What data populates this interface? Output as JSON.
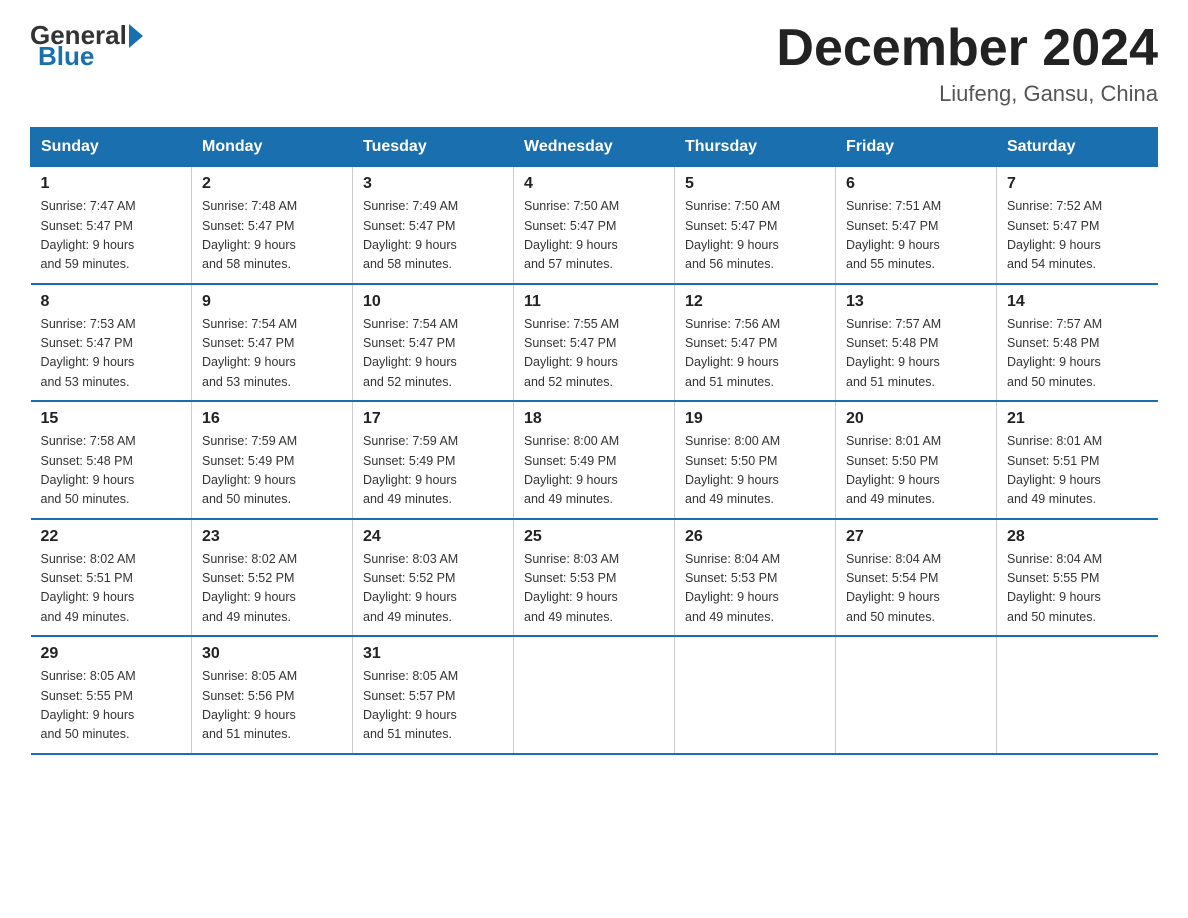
{
  "header": {
    "logo_general": "General",
    "logo_blue": "Blue",
    "month_title": "December 2024",
    "location": "Liufeng, Gansu, China"
  },
  "weekdays": [
    "Sunday",
    "Monday",
    "Tuesday",
    "Wednesday",
    "Thursday",
    "Friday",
    "Saturday"
  ],
  "weeks": [
    [
      {
        "day": "1",
        "info": "Sunrise: 7:47 AM\nSunset: 5:47 PM\nDaylight: 9 hours\nand 59 minutes."
      },
      {
        "day": "2",
        "info": "Sunrise: 7:48 AM\nSunset: 5:47 PM\nDaylight: 9 hours\nand 58 minutes."
      },
      {
        "day": "3",
        "info": "Sunrise: 7:49 AM\nSunset: 5:47 PM\nDaylight: 9 hours\nand 58 minutes."
      },
      {
        "day": "4",
        "info": "Sunrise: 7:50 AM\nSunset: 5:47 PM\nDaylight: 9 hours\nand 57 minutes."
      },
      {
        "day": "5",
        "info": "Sunrise: 7:50 AM\nSunset: 5:47 PM\nDaylight: 9 hours\nand 56 minutes."
      },
      {
        "day": "6",
        "info": "Sunrise: 7:51 AM\nSunset: 5:47 PM\nDaylight: 9 hours\nand 55 minutes."
      },
      {
        "day": "7",
        "info": "Sunrise: 7:52 AM\nSunset: 5:47 PM\nDaylight: 9 hours\nand 54 minutes."
      }
    ],
    [
      {
        "day": "8",
        "info": "Sunrise: 7:53 AM\nSunset: 5:47 PM\nDaylight: 9 hours\nand 53 minutes."
      },
      {
        "day": "9",
        "info": "Sunrise: 7:54 AM\nSunset: 5:47 PM\nDaylight: 9 hours\nand 53 minutes."
      },
      {
        "day": "10",
        "info": "Sunrise: 7:54 AM\nSunset: 5:47 PM\nDaylight: 9 hours\nand 52 minutes."
      },
      {
        "day": "11",
        "info": "Sunrise: 7:55 AM\nSunset: 5:47 PM\nDaylight: 9 hours\nand 52 minutes."
      },
      {
        "day": "12",
        "info": "Sunrise: 7:56 AM\nSunset: 5:47 PM\nDaylight: 9 hours\nand 51 minutes."
      },
      {
        "day": "13",
        "info": "Sunrise: 7:57 AM\nSunset: 5:48 PM\nDaylight: 9 hours\nand 51 minutes."
      },
      {
        "day": "14",
        "info": "Sunrise: 7:57 AM\nSunset: 5:48 PM\nDaylight: 9 hours\nand 50 minutes."
      }
    ],
    [
      {
        "day": "15",
        "info": "Sunrise: 7:58 AM\nSunset: 5:48 PM\nDaylight: 9 hours\nand 50 minutes."
      },
      {
        "day": "16",
        "info": "Sunrise: 7:59 AM\nSunset: 5:49 PM\nDaylight: 9 hours\nand 50 minutes."
      },
      {
        "day": "17",
        "info": "Sunrise: 7:59 AM\nSunset: 5:49 PM\nDaylight: 9 hours\nand 49 minutes."
      },
      {
        "day": "18",
        "info": "Sunrise: 8:00 AM\nSunset: 5:49 PM\nDaylight: 9 hours\nand 49 minutes."
      },
      {
        "day": "19",
        "info": "Sunrise: 8:00 AM\nSunset: 5:50 PM\nDaylight: 9 hours\nand 49 minutes."
      },
      {
        "day": "20",
        "info": "Sunrise: 8:01 AM\nSunset: 5:50 PM\nDaylight: 9 hours\nand 49 minutes."
      },
      {
        "day": "21",
        "info": "Sunrise: 8:01 AM\nSunset: 5:51 PM\nDaylight: 9 hours\nand 49 minutes."
      }
    ],
    [
      {
        "day": "22",
        "info": "Sunrise: 8:02 AM\nSunset: 5:51 PM\nDaylight: 9 hours\nand 49 minutes."
      },
      {
        "day": "23",
        "info": "Sunrise: 8:02 AM\nSunset: 5:52 PM\nDaylight: 9 hours\nand 49 minutes."
      },
      {
        "day": "24",
        "info": "Sunrise: 8:03 AM\nSunset: 5:52 PM\nDaylight: 9 hours\nand 49 minutes."
      },
      {
        "day": "25",
        "info": "Sunrise: 8:03 AM\nSunset: 5:53 PM\nDaylight: 9 hours\nand 49 minutes."
      },
      {
        "day": "26",
        "info": "Sunrise: 8:04 AM\nSunset: 5:53 PM\nDaylight: 9 hours\nand 49 minutes."
      },
      {
        "day": "27",
        "info": "Sunrise: 8:04 AM\nSunset: 5:54 PM\nDaylight: 9 hours\nand 50 minutes."
      },
      {
        "day": "28",
        "info": "Sunrise: 8:04 AM\nSunset: 5:55 PM\nDaylight: 9 hours\nand 50 minutes."
      }
    ],
    [
      {
        "day": "29",
        "info": "Sunrise: 8:05 AM\nSunset: 5:55 PM\nDaylight: 9 hours\nand 50 minutes."
      },
      {
        "day": "30",
        "info": "Sunrise: 8:05 AM\nSunset: 5:56 PM\nDaylight: 9 hours\nand 51 minutes."
      },
      {
        "day": "31",
        "info": "Sunrise: 8:05 AM\nSunset: 5:57 PM\nDaylight: 9 hours\nand 51 minutes."
      },
      {
        "day": "",
        "info": ""
      },
      {
        "day": "",
        "info": ""
      },
      {
        "day": "",
        "info": ""
      },
      {
        "day": "",
        "info": ""
      }
    ]
  ]
}
